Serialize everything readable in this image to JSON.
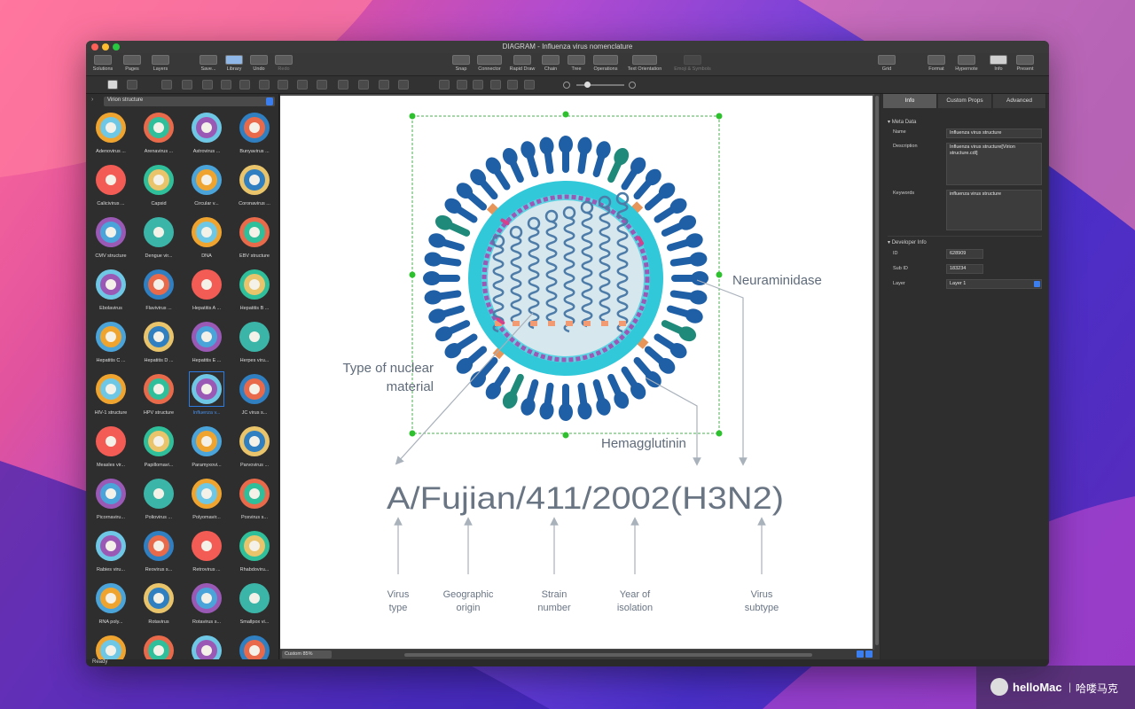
{
  "window": {
    "title": "DIAGRAM - Influenza virus nomenclature",
    "status": "Ready"
  },
  "toolbar": {
    "left": [
      {
        "label": "Solutions",
        "icon": "solutions-icon"
      },
      {
        "label": "Pages",
        "icon": "pages-icon"
      },
      {
        "label": "Layers",
        "icon": "layers-icon"
      },
      {
        "label": "Save...",
        "icon": "save-icon"
      },
      {
        "label": "Library",
        "icon": "library-icon"
      },
      {
        "label": "Undo",
        "icon": "undo-icon"
      },
      {
        "label": "Redo",
        "icon": "redo-icon"
      }
    ],
    "center": [
      {
        "label": "Snap",
        "icon": "snap-icon"
      },
      {
        "label": "Connector",
        "icon": "connector-icon"
      },
      {
        "label": "Rapid Draw",
        "icon": "rapid-draw-icon"
      },
      {
        "label": "Chain",
        "icon": "chain-icon"
      },
      {
        "label": "Tree",
        "icon": "tree-icon"
      },
      {
        "label": "Operations",
        "icon": "operations-icon"
      },
      {
        "label": "Text Orientation",
        "icon": "text-orientation-icon"
      },
      {
        "label": "Emoji & Symbols",
        "icon": "emoji-icon"
      }
    ],
    "right": [
      {
        "label": "Grid",
        "icon": "grid-icon"
      },
      {
        "label": "Format",
        "icon": "format-icon"
      },
      {
        "label": "Hypernote",
        "icon": "hypernote-icon"
      },
      {
        "label": "Info",
        "icon": "info-icon"
      },
      {
        "label": "Present",
        "icon": "present-icon"
      }
    ]
  },
  "library": {
    "selected": "Virion structure",
    "shapes": [
      "Adenovirus ...",
      "Arenavirus ...",
      "Astrovirus ...",
      "Bunyavirus ...",
      "Calicivirus ...",
      "Capsid",
      "Circular v...",
      "Coronavirus ...",
      "CMV structure",
      "Dengue vir...",
      "DNA",
      "EBV structure",
      "Ebolavirus",
      "Flavivirus ...",
      "Hepatitis A ...",
      "Hepatitis B ...",
      "Hepatitis C ...",
      "Hepatitis D ...",
      "Hepatitis E ...",
      "Herpes viru...",
      "HIV-1 structure",
      "HPV structure",
      "Influenza v...",
      "JC virus s...",
      "Measles vir...",
      "Papillomavi...",
      "Paramyxovi...",
      "Parvovirus ...",
      "Picornaviru...",
      "Poliovirus ...",
      "Polyomavir...",
      "Poxvirus s...",
      "Rabies viru...",
      "Reovirus s...",
      "Retrovirus ...",
      "Rhabdoviru...",
      "RNA poly...",
      "Rotavirus",
      "Rotavirus s...",
      "Smallpox vi...",
      "",
      "",
      "",
      ""
    ],
    "selected_index": 22
  },
  "canvas": {
    "zoom": "Custom 85%",
    "name_code": "A/Fujian/411/2002(H3N2)",
    "labels": {
      "neuraminidase": "Neuraminidase",
      "hemagglutinin": "Hemagglutinin",
      "nuclear_line1": "Type of nuclear",
      "nuclear_line2": "material"
    },
    "bottom_labels": [
      {
        "line1": "Virus",
        "line2": "type"
      },
      {
        "line1": "Geographic",
        "line2": "origin"
      },
      {
        "line1": "Strain",
        "line2": "number"
      },
      {
        "line1": "Year of",
        "line2": "isolation"
      },
      {
        "line1": "Virus",
        "line2": "subtype"
      }
    ]
  },
  "inspector": {
    "tabs": [
      "Info",
      "Custom Props",
      "Advanced"
    ],
    "active_tab": "Info",
    "meta_data": {
      "section": "Meta Data",
      "name_label": "Name",
      "name": "Influenza virus structure",
      "description_label": "Description",
      "description_line1": "Influenza virus structure[Virion",
      "description_line2": "structure.cdl]",
      "keywords_label": "Keywords",
      "keywords": "influenza virus structure"
    },
    "developer_info": {
      "section": "Developer Info",
      "id_label": "ID",
      "id": "628909",
      "sub_id_label": "Sub ID",
      "sub_id": "183234",
      "layer_label": "Layer",
      "layer": "Layer 1"
    }
  },
  "watermark": {
    "brand": "helloMac",
    "cn": "哈喽马克"
  }
}
